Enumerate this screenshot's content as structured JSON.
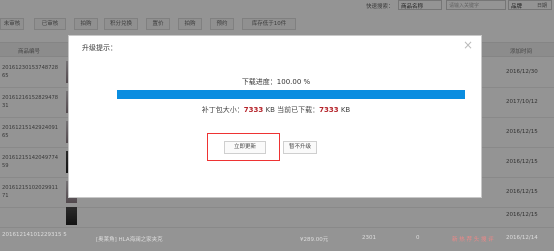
{
  "quick_search": {
    "label": "快速搜索：",
    "field_select": "商品名称",
    "input_placeholder": "请输入关键字",
    "brand_select": "品牌",
    "edge_text": "日期"
  },
  "filter_tabs": [
    "未审核",
    "已审核",
    "拍购",
    "积分兑换",
    "置价",
    "拍购",
    "预约",
    "库存低于10件"
  ],
  "table_header": {
    "order_no": "商品编号",
    "date": "添加时间"
  },
  "rows": [
    {
      "order_no": "20161230153748728 65",
      "date": "2016/12/30"
    },
    {
      "order_no": "20161216152829478 31",
      "date": "2017/10/12"
    },
    {
      "order_no": "20161215142924091 65",
      "date": "2016/12/15"
    },
    {
      "order_no": "20161215142049774 59",
      "date": "2016/12/15"
    },
    {
      "order_no": "20161215102029911 71",
      "date": "2016/12/15"
    },
    {
      "order_no": "",
      "date": "2016/12/15"
    }
  ],
  "last_row": {
    "order_no": "20161214101229315 5",
    "product": "[奥莱角] HLA海澜之家夹克",
    "price": "¥289.00元",
    "stock": "2301",
    "sales": "0",
    "tags": "新 热 荐 头 搜 评",
    "date": "2016/12/14"
  },
  "modal": {
    "title": "升级提示：",
    "close": "×",
    "progress_text": "下载进度：100.00 %",
    "progress_percent": 100,
    "size_prefix": "补丁包大小：",
    "size_total": "7333",
    "size_mid": " KB 当前已下载：",
    "size_downloaded": "7333",
    "size_suffix": " KB",
    "update_now": "立即更新",
    "skip": "暂不升级"
  },
  "colors": {
    "progress": "#0a8de0",
    "highlight": "#e33333",
    "number": "#b5232a"
  }
}
